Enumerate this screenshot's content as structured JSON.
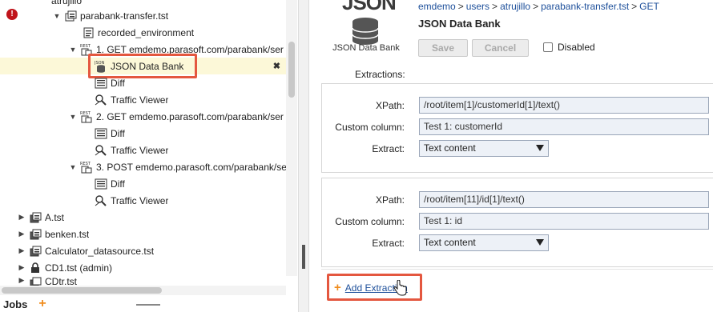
{
  "tree": {
    "partial_top_label": "atrujillo",
    "items": [
      {
        "label": "parabank-transfer.tst"
      },
      {
        "label": "recorded_environment"
      },
      {
        "label": "1. GET emdemo.parasoft.com/parabank/ser"
      },
      {
        "label": "JSON Data Bank"
      },
      {
        "label": "Diff"
      },
      {
        "label": "Traffic Viewer"
      },
      {
        "label": "2. GET emdemo.parasoft.com/parabank/ser"
      },
      {
        "label": "Diff"
      },
      {
        "label": "Traffic Viewer"
      },
      {
        "label": "3. POST emdemo.parasoft.com/parabank/se"
      },
      {
        "label": "Diff"
      },
      {
        "label": "Traffic Viewer"
      },
      {
        "label": "A.tst"
      },
      {
        "label": "benken.tst"
      },
      {
        "label": "Calculator_datasource.tst"
      },
      {
        "label": "CD1.tst (admin)"
      },
      {
        "label": "CDtr.tst"
      }
    ],
    "close_glyph": "✖"
  },
  "jobs": {
    "label": "Jobs",
    "plus": "+"
  },
  "detail": {
    "logo_text": "JSON",
    "logo_caption": "JSON Data Bank",
    "breadcrumb": [
      "emdemo",
      "users",
      "atrujillo",
      "parabank-transfer.tst",
      "GET"
    ],
    "breadcrumb_sep": ">",
    "title": "JSON Data Bank",
    "save_label": "Save",
    "cancel_label": "Cancel",
    "disabled_label": "Disabled",
    "extractions_label": "Extractions:",
    "extractions": [
      {
        "xpath_label": "XPath:",
        "xpath": "/root/item[1]/customerId[1]/text()",
        "column_label": "Custom column:",
        "column": "Test 1: customerId",
        "extract_label": "Extract:",
        "extract": "Text content"
      },
      {
        "xpath_label": "XPath:",
        "xpath": "/root/item[11]/id[1]/text()",
        "column_label": "Custom column:",
        "column": "Test 1: id",
        "extract_label": "Extract:",
        "extract": "Text content"
      }
    ],
    "add_plus": "+",
    "add_label": "Add Extraction"
  },
  "colors": {
    "accent": "#f08c1c",
    "highlight": "#e4573f",
    "link": "#1d4f9a",
    "selected_row": "#fcf8d8",
    "error": "#c0141b"
  }
}
